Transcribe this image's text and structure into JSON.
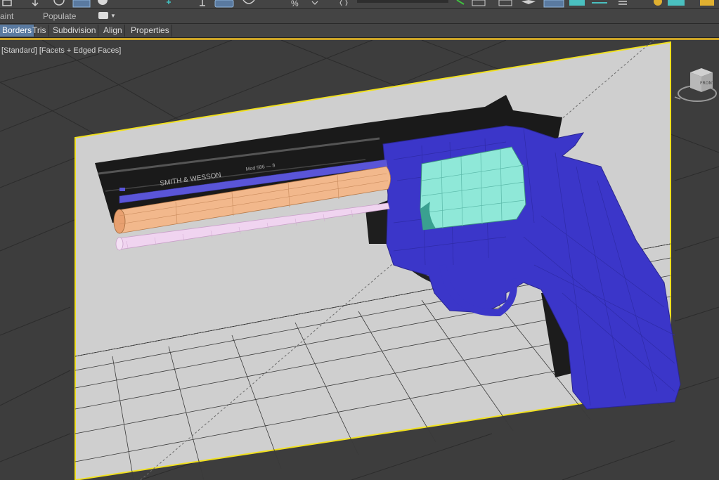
{
  "ribbon": {
    "tabs": [
      "aint",
      "Populate"
    ]
  },
  "subtabs": [
    "Borders",
    "Tris",
    "Subdivision",
    "Align",
    "Properties"
  ],
  "viewport": {
    "label": "[Standard] [Facets + Edged Faces]",
    "viewcube_face": "FRONT",
    "engraving": "SMITH & WESSON",
    "engraving_model": "Mod 586 — 8"
  },
  "colors": {
    "selection_border": "#f0e020",
    "accent": "#c9a227",
    "active_tab": "#5a7aa0",
    "mesh_blue": "#3b36c9",
    "cylinder_cyan": "#8fe8d8",
    "barrel_orange": "#f2b88c",
    "rod_pink": "#f0d4f0"
  },
  "icons": [
    "move-icon",
    "rotate-icon",
    "select-icon",
    "sphere-icon",
    "snap-icon",
    "percent-snap-icon",
    "layer-icon",
    "scene-explorer-icon",
    "render-setup-icon",
    "render-icon",
    "viewcube-icon"
  ]
}
